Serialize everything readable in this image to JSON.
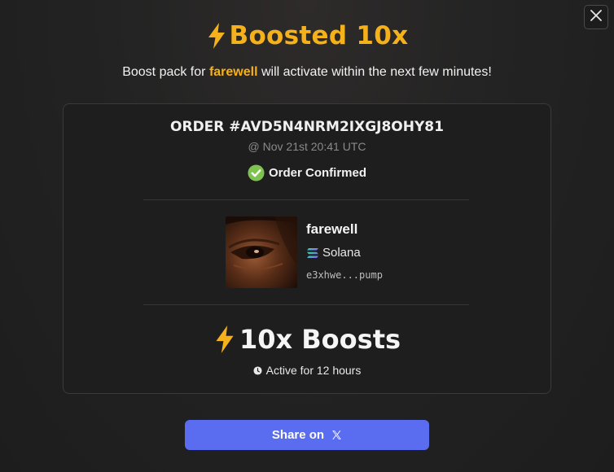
{
  "header": {
    "title": "Boosted 10x",
    "subtitle_before": "Boost pack for",
    "subtitle_token": "farewell",
    "subtitle_after": "will activate within the next few minutes!"
  },
  "order": {
    "id": "ORDER #AVD5N4NRM2IXGJ8OHY81",
    "time": "@ Nov 21st 20:41 UTC",
    "status": "Order Confirmed"
  },
  "token": {
    "name": "farewell",
    "chain": "Solana",
    "address": "e3xhwe...pump"
  },
  "boost": {
    "count_label": "10x Boosts",
    "duration": "Active for 12 hours"
  },
  "share": {
    "label": "Share on"
  },
  "icons": {
    "close": "close-icon",
    "bolt": "lightning-bolt-icon",
    "check": "check-circle-icon",
    "chain": "solana-icon",
    "clock": "clock-icon",
    "x": "x-logo-icon"
  },
  "colors": {
    "accent": "#f5b11c",
    "confirmed": "#7ec24f",
    "share_button": "#5a6cf0",
    "background": "#232323"
  }
}
